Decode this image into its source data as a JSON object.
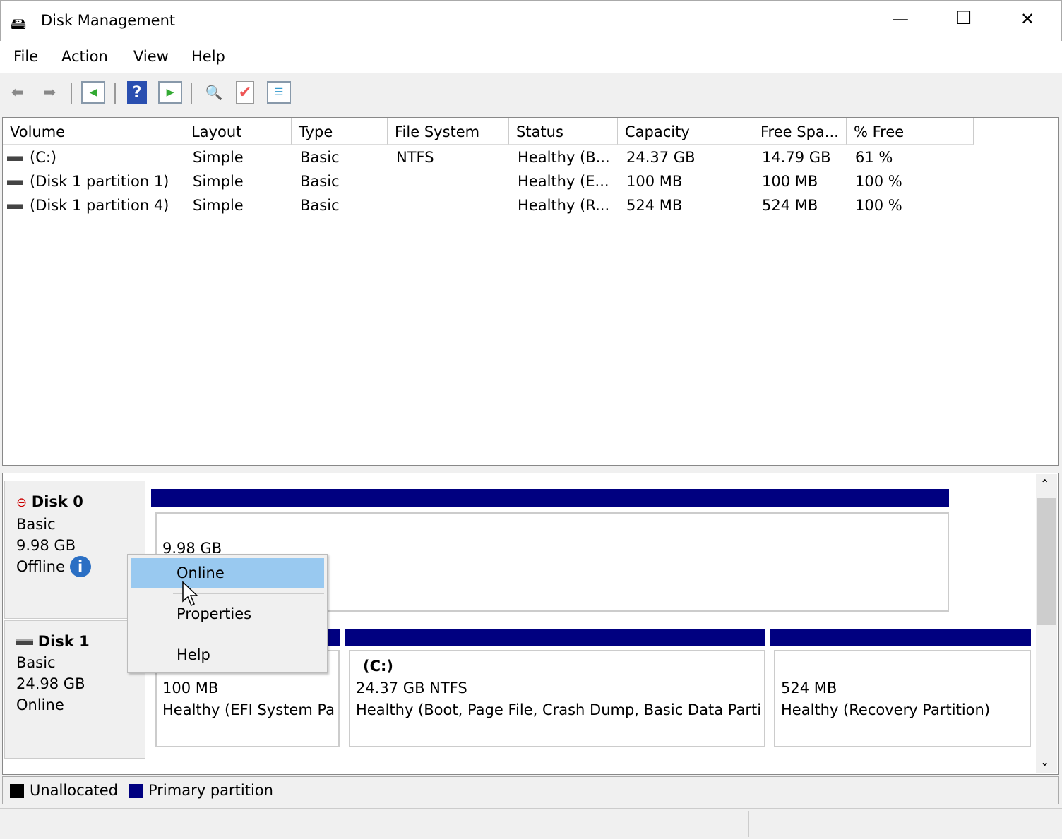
{
  "window": {
    "title": "Disk Management",
    "icon": "disk-management-icon",
    "controls": {
      "minimize": "—",
      "maximize": "☐",
      "close": "✕"
    }
  },
  "menu": [
    "File",
    "Action",
    "View",
    "Help"
  ],
  "toolbar": [
    "back-icon",
    "forward-icon",
    "show-hide-console-tree-icon",
    "help-icon",
    "show-hide-action-pane-icon",
    "rescan-disks-icon",
    "properties-icon",
    "checklist-icon"
  ],
  "volumes": {
    "columns": [
      "Volume",
      "Layout",
      "Type",
      "File System",
      "Status",
      "Capacity",
      "Free Spa...",
      "% Free"
    ],
    "rows": [
      [
        "(C:)",
        "Simple",
        "Basic",
        "NTFS",
        "Healthy (B...",
        "24.37 GB",
        "14.79 GB",
        "61 %"
      ],
      [
        "(Disk 1 partition 1)",
        "Simple",
        "Basic",
        "",
        "Healthy (E...",
        "100 MB",
        "100 MB",
        "100 %"
      ],
      [
        "(Disk 1 partition 4)",
        "Simple",
        "Basic",
        "",
        "Healthy (R...",
        "524 MB",
        "524 MB",
        "100 %"
      ]
    ]
  },
  "disks": [
    {
      "name": "Disk 0",
      "type": "Basic",
      "size": "9.98 GB",
      "state": "Offline",
      "partitions": [
        {
          "size": "9.98 GB"
        }
      ]
    },
    {
      "name": "Disk 1",
      "type": "Basic",
      "size": "24.98 GB",
      "state": "Online",
      "partitions": [
        {
          "title": "",
          "size": "100 MB",
          "status": "Healthy (EFI System Pa"
        },
        {
          "title": "(C:)",
          "size": "24.37 GB NTFS",
          "status": "Healthy (Boot, Page File, Crash Dump, Basic Data Parti"
        },
        {
          "title": "",
          "size": "524 MB",
          "status": "Healthy (Recovery Partition)"
        }
      ]
    }
  ],
  "legend": [
    {
      "label": "Unallocated",
      "color": "#000000"
    },
    {
      "label": "Primary partition",
      "color": "#000080"
    }
  ],
  "context_menu": {
    "items": [
      "Online",
      "Properties",
      "Help"
    ],
    "highlighted": "Online"
  }
}
